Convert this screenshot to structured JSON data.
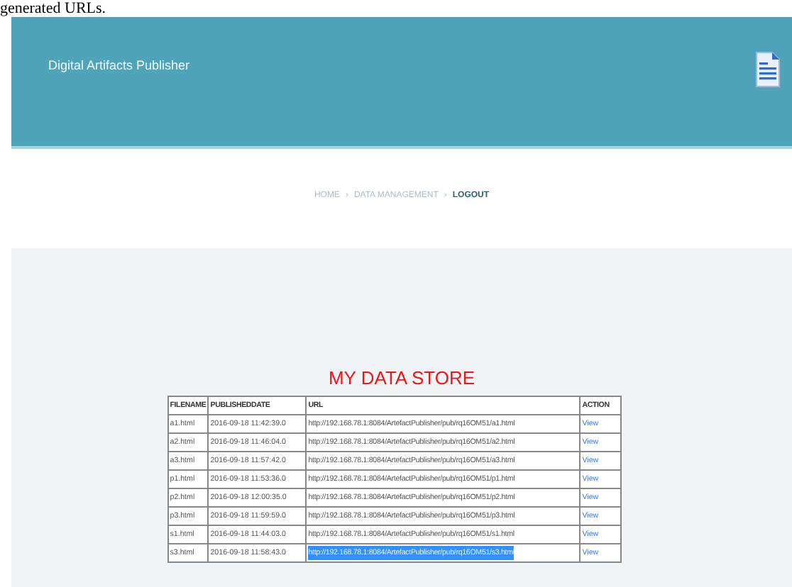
{
  "caption": "generated URLs.",
  "header": {
    "title": "Digital Artifacts Publisher"
  },
  "breadcrumb": [
    {
      "label": "HOME",
      "current": false
    },
    {
      "label": "DATA MANAGEMENT",
      "current": false
    },
    {
      "label": "LOGOUT",
      "current": true
    }
  ],
  "separator": "›",
  "page_title": "MY DATA STORE",
  "table": {
    "columns": [
      "FILENAME",
      "PUBLISHEDDATE",
      "URL",
      "ACTION"
    ],
    "rows": [
      {
        "filename": "a1.html",
        "date": "2016-09-18 11:42:39.0",
        "url": "http://192.168.78.1:8084/ArtefactPublisher/pub/rq16OM51/a1.html",
        "action": "View",
        "url_highlighted": false
      },
      {
        "filename": "a2.html",
        "date": "2016-09-18 11:46:04.0",
        "url": "http://192.168.78.1:8084/ArtefactPublisher/pub/rq16OM51/a2.html",
        "action": "View",
        "url_highlighted": false
      },
      {
        "filename": "a3.html",
        "date": "2016-09-18 11:57:42.0",
        "url": "http://192.168.78.1:8084/ArtefactPublisher/pub/rq16OM51/a3.html",
        "action": "View",
        "url_highlighted": false
      },
      {
        "filename": "p1.html",
        "date": "2016-09-18 11:53:36.0",
        "url": "http://192.168.78.1:8084/ArtefactPublisher/pub/rq16OM51/p1.html",
        "action": "View",
        "url_highlighted": false
      },
      {
        "filename": "p2.html",
        "date": "2016-09-18 12:00:35.0",
        "url": "http://192.168.78.1:8084/ArtefactPublisher/pub/rq16OM51/p2.html",
        "action": "View",
        "url_highlighted": false
      },
      {
        "filename": "p3.html",
        "date": "2016-09-18 11:59:59.0",
        "url": "http://192.168.78.1:8084/ArtefactPublisher/pub/rq16OM51/p3.html",
        "action": "View",
        "url_highlighted": false
      },
      {
        "filename": "s1.html",
        "date": "2016-09-18 11:44:03.0",
        "url": "http://192.168.78.1:8084/ArtefactPublisher/pub/rq16OM51/s1.html",
        "action": "View",
        "url_highlighted": false
      },
      {
        "filename": "s3.html",
        "date": "2016-09-18 11:58:43.0",
        "url": "http://192.168.78.1:8084/ArtefactPublisher/pub/rq16OM51/s3.html",
        "action": "View",
        "url_highlighted": true
      }
    ]
  }
}
